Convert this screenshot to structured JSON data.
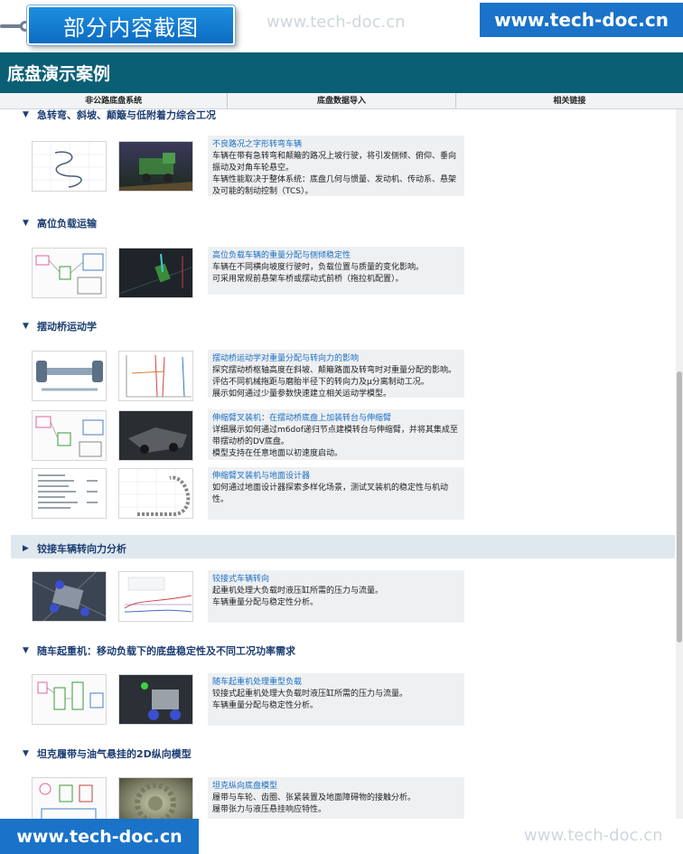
{
  "capture_label": "部分内容截图",
  "watermark": "www.tech-doc.cn",
  "site_badge": "www.tech-doc.cn",
  "page_title": "底盘演示案例",
  "nav": [
    "非公路底盘系统",
    "底盘数据导入",
    "相关链接"
  ],
  "sections": [
    {
      "title": "急转弯、斜坡、颠簸与低附着力综合工况"
    },
    {
      "title": "高位负载运输"
    },
    {
      "title": "摆动桥运动学"
    },
    {
      "title": "铰接车辆转向力分析"
    },
    {
      "title": "随车起重机：移动负载下的底盘稳定性及不同工况功率需求"
    },
    {
      "title": "坦克履带与油气悬挂的2D纵向模型"
    }
  ],
  "cards": [
    {
      "title": "不良路况之字形转弯车辆",
      "lines": [
        "车辆在带有急转弯和颠簸的路况上坡行驶，将引发侧倾、俯仰、垂向振动及对角车轮悬空。",
        "车辆性能取决于整体系统：底盘几何与惯量、发动机、传动系、悬架及可能的制动控制（TCS）。"
      ]
    },
    {
      "title": "高位负载车辆的重量分配与侧倾稳定性",
      "lines": [
        "车辆在不同横向坡度行驶时，负载位置与质量的变化影响。",
        "可采用常规前悬架车桥或摆动式前桥（拖拉机配置）。"
      ]
    },
    {
      "title": "摆动桥运动学对重量分配与转向力的影响",
      "lines": [
        "探究摆动桥枢轴高度在斜坡、颠簸路面及转弯时对重量分配的影响。",
        "评估不同机械拖距与磨胎半径下的转向力及μ分离制动工况。",
        "展示如何通过少量参数快速建立相关运动学模型。"
      ]
    },
    {
      "title": "伸缩臂叉装机：在摆动桥底盘上加装转台与伸缩臂",
      "lines": [
        "详细展示如何通过m6dof递归节点建模转台与伸缩臂，并将其集成至带摆动桥的DV底盘。",
        "模型支持在任意地面以初速度启动。"
      ]
    },
    {
      "title": "伸缩臂叉装机与地面设计器",
      "lines": [
        "如何通过地面设计器探索多样化场景，测试叉装机的稳定性与机动性。"
      ]
    },
    {
      "title": "铰接式车辆转向",
      "lines": [
        "起重机处理大负载时液压缸所需的压力与流量。",
        "车辆重量分配与稳定性分析。"
      ]
    },
    {
      "title": "随车起重机处理重型负载",
      "lines": [
        "铰接式起重机处理大负载时液压缸所需的压力与流量。",
        "车辆重量分配与稳定性分析。"
      ]
    },
    {
      "title": "坦克纵向底盘模型",
      "lines": [
        "履带与车轮、齿圈、张紧装置及地面障碍物的接触分析。",
        "履带张力与液压悬挂响应特性。"
      ]
    }
  ]
}
